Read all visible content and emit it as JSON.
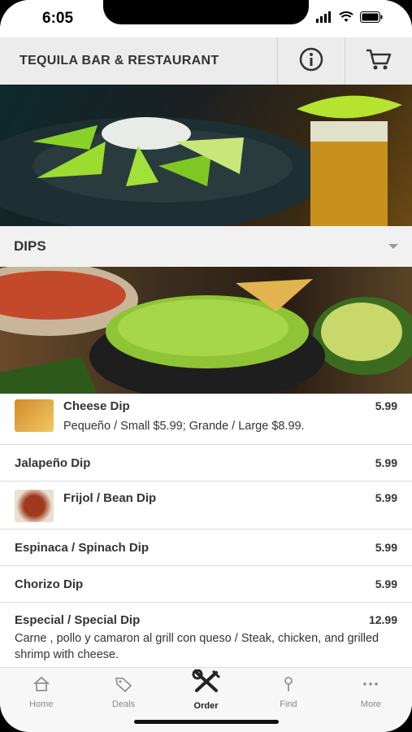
{
  "status": {
    "time": "6:05"
  },
  "header": {
    "title": "TEQUILA BAR & RESTAURANT",
    "info_icon": "info-icon",
    "cart_icon": "cart-icon"
  },
  "section": {
    "title": "DIPS",
    "icon": "chevron-down-icon"
  },
  "items": [
    {
      "name": "Cheese Dip",
      "price": "5.99",
      "desc": "Pequeño / Small $5.99; Grande / Large $8.99."
    },
    {
      "name": "Jalapeño Dip",
      "price": "5.99"
    },
    {
      "name": "Frijol / Bean Dip",
      "price": "5.99"
    },
    {
      "name": "Espinaca / Spinach Dip",
      "price": "5.99"
    },
    {
      "name": "Chorizo Dip",
      "price": "5.99"
    },
    {
      "name": "Especial / Special Dip",
      "price": "12.99",
      "desc": "Carne , pollo y camaron al grill con queso / Steak, chicken, and grilled shrimp with cheese."
    }
  ],
  "tabs": [
    {
      "label": "Home",
      "icon": "home-icon"
    },
    {
      "label": "Deals",
      "icon": "tag-icon"
    },
    {
      "label": "Order",
      "icon": "utensils-icon"
    },
    {
      "label": "Find",
      "icon": "pin-icon"
    },
    {
      "label": "More",
      "icon": "more-icon"
    }
  ],
  "colors": {
    "header_bg": "#ececec",
    "section_bg": "#f1f1f1",
    "text": "#333333",
    "tab_inactive": "#888888"
  }
}
